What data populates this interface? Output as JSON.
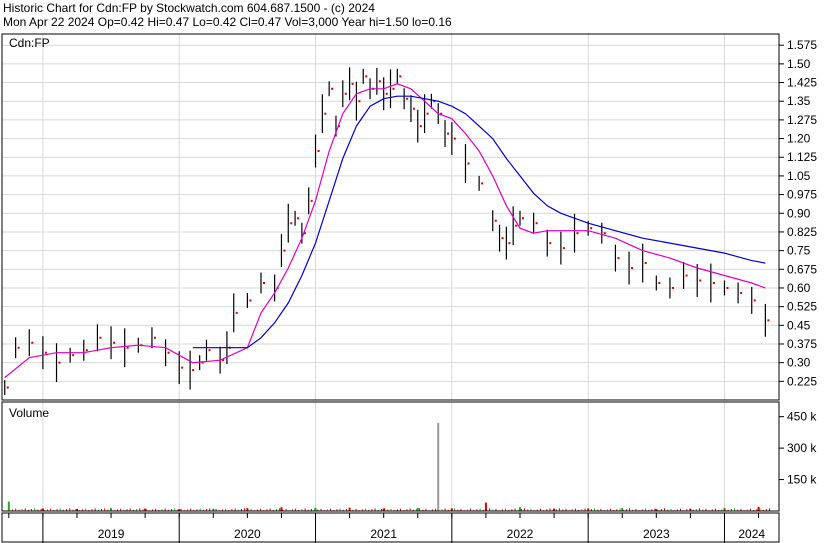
{
  "header": {
    "line1": "Historic Chart for Cdn:FP by Stockwatch.com 604.687.1500 - (c) 2024",
    "line2": "Mon Apr 22 2024  Op=0.42  Hi=0.47  Lo=0.42  Cl=0.47  Vol=3,000  Year hi=1.50  lo=0.16"
  },
  "colors": {
    "price": "#000000",
    "down_tick": "#dd0000",
    "ma_short": "#e000c8",
    "ma_long": "#0000cc",
    "volume_up": "#22aa22",
    "volume_down": "#dd0000",
    "volume_spike": "#999999",
    "grid": "#d8d8d8"
  },
  "chart_data": [
    {
      "type": "line",
      "title": "",
      "symbol_label": "Cdn:FP",
      "ylim": [
        0.15,
        1.62
      ],
      "y_ticks": [
        0.225,
        0.3,
        0.375,
        0.45,
        0.525,
        0.6,
        0.675,
        0.75,
        0.825,
        0.9,
        0.975,
        1.05,
        1.125,
        1.2,
        1.275,
        1.35,
        1.425,
        1.5,
        1.575
      ],
      "y_tick_labels": [
        "0.225",
        "0.30",
        "0.375",
        "0.45",
        "0.525",
        "0.60",
        "0.675",
        "0.75",
        "0.825",
        "0.90",
        "0.975",
        "1.05",
        "1.125",
        "1.20",
        "1.275",
        "1.35",
        "1.425",
        "1.50",
        "1.575"
      ],
      "x_labels": [
        "2019",
        "2020",
        "2021",
        "2022",
        "2023",
        "2024"
      ],
      "xlim": [
        2018.7,
        2024.4
      ],
      "grid": true,
      "series": [
        {
          "style": "price",
          "x": [
            2018.72,
            2018.8,
            2018.9,
            2019.0,
            2019.1,
            2019.2,
            2019.3,
            2019.4,
            2019.5,
            2019.6,
            2019.7,
            2019.8,
            2019.9,
            2020.0,
            2020.08,
            2020.15,
            2020.2,
            2020.3,
            2020.35,
            2020.4,
            2020.5,
            2020.6,
            2020.7,
            2020.75,
            2020.8,
            2020.85,
            2020.9,
            2020.95,
            2021.0,
            2021.05,
            2021.1,
            2021.15,
            2021.2,
            2021.25,
            2021.3,
            2021.35,
            2021.4,
            2021.45,
            2021.5,
            2021.55,
            2021.6,
            2021.65,
            2021.7,
            2021.75,
            2021.8,
            2021.85,
            2021.9,
            2021.95,
            2022.0,
            2022.1,
            2022.2,
            2022.3,
            2022.35,
            2022.4,
            2022.45,
            2022.5,
            2022.6,
            2022.7,
            2022.8,
            2022.9,
            2023.0,
            2023.1,
            2023.2,
            2023.3,
            2023.4,
            2023.5,
            2023.6,
            2023.7,
            2023.8,
            2023.9,
            2024.0,
            2024.1,
            2024.2,
            2024.3
          ],
          "y": [
            0.2,
            0.36,
            0.38,
            0.34,
            0.3,
            0.33,
            0.35,
            0.4,
            0.38,
            0.36,
            0.37,
            0.4,
            0.34,
            0.28,
            0.27,
            0.3,
            0.35,
            0.31,
            0.36,
            0.5,
            0.55,
            0.62,
            0.6,
            0.75,
            0.86,
            0.88,
            0.82,
            0.95,
            1.15,
            1.3,
            1.4,
            1.25,
            1.38,
            1.42,
            1.35,
            1.45,
            1.4,
            1.43,
            1.38,
            1.4,
            1.45,
            1.36,
            1.32,
            1.25,
            1.3,
            1.35,
            1.3,
            1.22,
            1.2,
            1.1,
            1.02,
            0.87,
            0.8,
            0.78,
            0.85,
            0.88,
            0.86,
            0.78,
            0.76,
            0.82,
            0.84,
            0.82,
            0.72,
            0.68,
            0.7,
            0.62,
            0.6,
            0.65,
            0.63,
            0.62,
            0.6,
            0.58,
            0.55,
            0.47
          ]
        },
        {
          "style": "ma_short",
          "x": [
            2018.72,
            2018.9,
            2019.1,
            2019.3,
            2019.5,
            2019.7,
            2019.9,
            2020.1,
            2020.3,
            2020.5,
            2020.6,
            2020.7,
            2020.8,
            2020.9,
            2021.0,
            2021.1,
            2021.2,
            2021.3,
            2021.4,
            2021.5,
            2021.6,
            2021.7,
            2021.8,
            2021.9,
            2022.0,
            2022.1,
            2022.2,
            2022.3,
            2022.4,
            2022.5,
            2022.6,
            2022.7,
            2022.8,
            2022.9,
            2023.0,
            2023.2,
            2023.4,
            2023.6,
            2023.8,
            2024.0,
            2024.2,
            2024.3
          ],
          "y": [
            0.24,
            0.32,
            0.34,
            0.34,
            0.36,
            0.37,
            0.36,
            0.3,
            0.31,
            0.36,
            0.5,
            0.58,
            0.68,
            0.8,
            0.95,
            1.15,
            1.3,
            1.38,
            1.4,
            1.4,
            1.42,
            1.4,
            1.35,
            1.3,
            1.28,
            1.22,
            1.15,
            1.05,
            0.93,
            0.84,
            0.82,
            0.83,
            0.83,
            0.83,
            0.83,
            0.8,
            0.75,
            0.72,
            0.68,
            0.65,
            0.62,
            0.6
          ]
        },
        {
          "style": "ma_long",
          "x": [
            2020.1,
            2020.3,
            2020.5,
            2020.6,
            2020.7,
            2020.8,
            2020.9,
            2021.0,
            2021.1,
            2021.2,
            2021.3,
            2021.4,
            2021.5,
            2021.6,
            2021.7,
            2021.8,
            2021.9,
            2022.0,
            2022.1,
            2022.2,
            2022.3,
            2022.4,
            2022.5,
            2022.6,
            2022.7,
            2022.8,
            2022.9,
            2023.0,
            2023.2,
            2023.4,
            2023.6,
            2023.8,
            2024.0,
            2024.2,
            2024.3
          ],
          "y": [
            0.36,
            0.36,
            0.36,
            0.4,
            0.46,
            0.54,
            0.65,
            0.78,
            0.95,
            1.12,
            1.25,
            1.33,
            1.36,
            1.37,
            1.37,
            1.36,
            1.35,
            1.33,
            1.3,
            1.25,
            1.2,
            1.12,
            1.05,
            0.98,
            0.93,
            0.9,
            0.88,
            0.86,
            0.83,
            0.8,
            0.78,
            0.76,
            0.74,
            0.71,
            0.7
          ]
        }
      ]
    },
    {
      "type": "bar",
      "title": "",
      "panel_label": "Volume",
      "ylim": [
        0,
        520000
      ],
      "y_ticks": [
        150000,
        300000,
        450000
      ],
      "y_tick_labels": [
        "150 k",
        "300 k",
        "450 k"
      ],
      "spike": {
        "x": 2021.9,
        "value": 420000
      },
      "x": [
        2018.75,
        2019.0,
        2019.25,
        2019.5,
        2019.75,
        2020.0,
        2020.25,
        2020.5,
        2020.75,
        2021.0,
        2021.25,
        2021.5,
        2021.75,
        2022.0,
        2022.25,
        2022.5,
        2022.75,
        2023.0,
        2023.25,
        2023.5,
        2023.75,
        2024.0,
        2024.25
      ],
      "values": [
        45000,
        12000,
        10000,
        14000,
        12000,
        9000,
        11000,
        14000,
        18000,
        15000,
        16000,
        12000,
        14000,
        13000,
        40000,
        18000,
        12000,
        12000,
        14000,
        9000,
        10000,
        15000,
        20000
      ]
    }
  ]
}
